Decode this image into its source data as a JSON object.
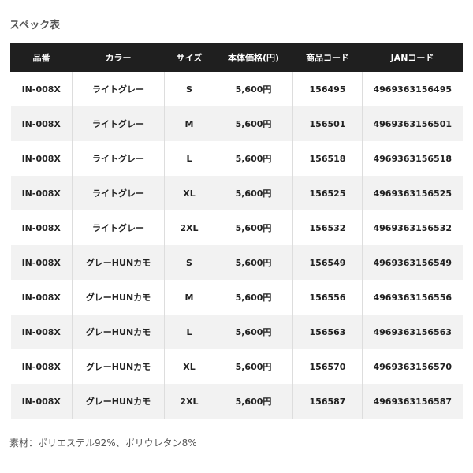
{
  "title": "スペック表",
  "table": {
    "headers": [
      "品番",
      "カラー",
      "サイズ",
      "本体価格(円)",
      "商品コード",
      "JANコード"
    ],
    "rows": [
      [
        "IN-008X",
        "ライトグレー",
        "S",
        "5,600円",
        "156495",
        "4969363156495"
      ],
      [
        "IN-008X",
        "ライトグレー",
        "M",
        "5,600円",
        "156501",
        "4969363156501"
      ],
      [
        "IN-008X",
        "ライトグレー",
        "L",
        "5,600円",
        "156518",
        "4969363156518"
      ],
      [
        "IN-008X",
        "ライトグレー",
        "XL",
        "5,600円",
        "156525",
        "4969363156525"
      ],
      [
        "IN-008X",
        "ライトグレー",
        "2XL",
        "5,600円",
        "156532",
        "4969363156532"
      ],
      [
        "IN-008X",
        "グレーHUNカモ",
        "S",
        "5,600円",
        "156549",
        "4969363156549"
      ],
      [
        "IN-008X",
        "グレーHUNカモ",
        "M",
        "5,600円",
        "156556",
        "4969363156556"
      ],
      [
        "IN-008X",
        "グレーHUNカモ",
        "L",
        "5,600円",
        "156563",
        "4969363156563"
      ],
      [
        "IN-008X",
        "グレーHUNカモ",
        "XL",
        "5,600円",
        "156570",
        "4969363156570"
      ],
      [
        "IN-008X",
        "グレーHUNカモ",
        "2XL",
        "5,600円",
        "156587",
        "4969363156587"
      ]
    ]
  },
  "footnote": "素材：ポリエステル92%、ポリウレタン8%",
  "colors": {
    "header_bg": "#1f1f1f",
    "header_text": "#ffffff",
    "row_alt_bg": "#f2f2f2"
  }
}
